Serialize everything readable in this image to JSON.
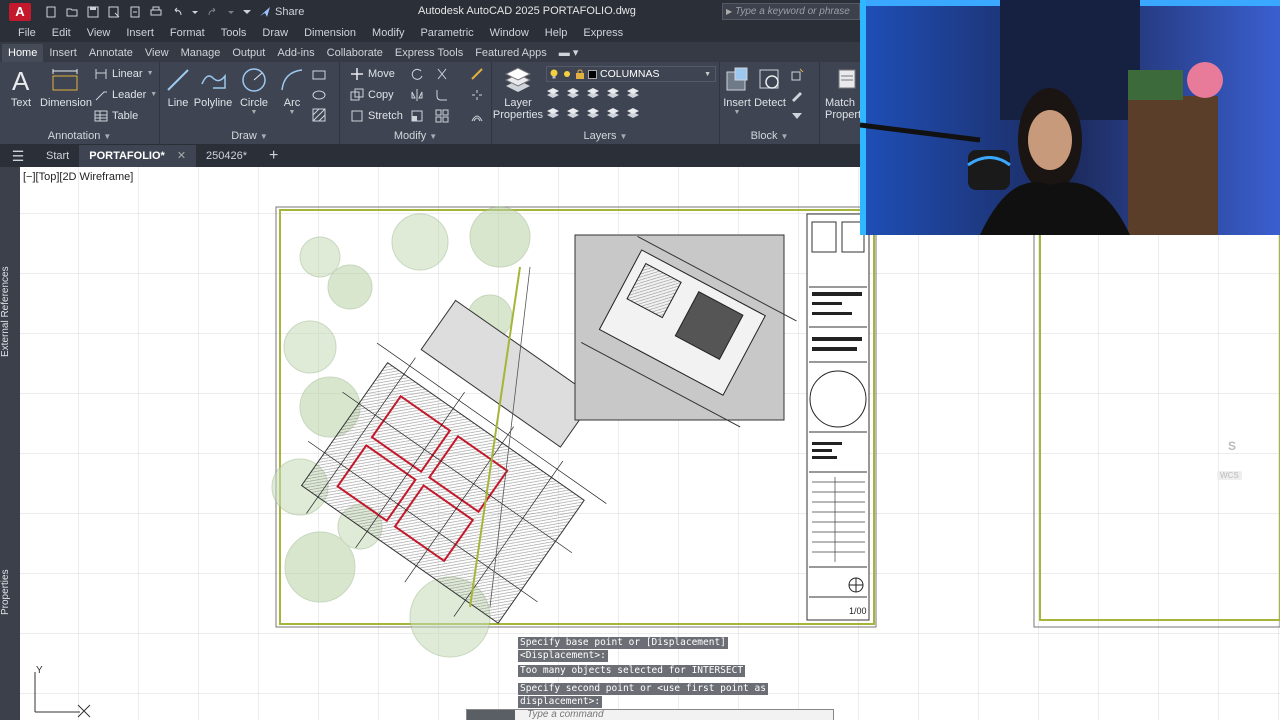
{
  "app": {
    "logo_letter": "A",
    "title": "Autodesk AutoCAD 2025   PORTAFOLIO.dwg",
    "share_label": "Share",
    "search_placeholder": "Type a keyword or phrase"
  },
  "menubar": [
    "File",
    "Edit",
    "View",
    "Insert",
    "Format",
    "Tools",
    "Draw",
    "Dimension",
    "Modify",
    "Parametric",
    "Window",
    "Help",
    "Express"
  ],
  "ribbon_tabs": [
    "Home",
    "Insert",
    "Annotate",
    "View",
    "Manage",
    "Output",
    "Add-ins",
    "Collaborate",
    "Express Tools",
    "Featured Apps"
  ],
  "ribbon": {
    "annotation": {
      "title": "Annotation",
      "text": "Text",
      "dimension": "Dimension",
      "linear": "Linear",
      "leader": "Leader",
      "table": "Table"
    },
    "draw": {
      "title": "Draw",
      "line": "Line",
      "polyline": "Polyline",
      "circle": "Circle",
      "arc": "Arc"
    },
    "modify": {
      "title": "Modify",
      "move": "Move",
      "copy": "Copy",
      "stretch": "Stretch"
    },
    "layers": {
      "title": "Layers",
      "layer_properties_1": "Layer",
      "layer_properties_2": "Properties",
      "current_layer": "COLUMNAS"
    },
    "block": {
      "title": "Block",
      "insert": "Insert",
      "detect": "Detect"
    },
    "properties": {
      "match_1": "Match",
      "match_2": "Properti"
    }
  },
  "file_tabs": {
    "start": "Start",
    "active": "PORTAFOLIO*",
    "other": "250426*"
  },
  "canvas": {
    "viewport_label": "[−][Top][2D Wireframe]",
    "side_labels": [
      "External References",
      "Properties"
    ],
    "title_block_scale": "1/00",
    "wcs": "WCS",
    "compass": "S",
    "ucs_y": "Y"
  },
  "command": {
    "lines": [
      "Specify base point or [Displacement]",
      "<Displacement>:",
      "Too many objects selected for INTERSECT",
      "Specify second point or <use first point as",
      "displacement>:"
    ],
    "input_placeholder": "Type a command"
  },
  "colors": {
    "accent_red": "#c4182c",
    "ribbon_bg": "#3e4451",
    "title_bg": "#2b2f37",
    "sheet_border": "#a6b53a"
  }
}
